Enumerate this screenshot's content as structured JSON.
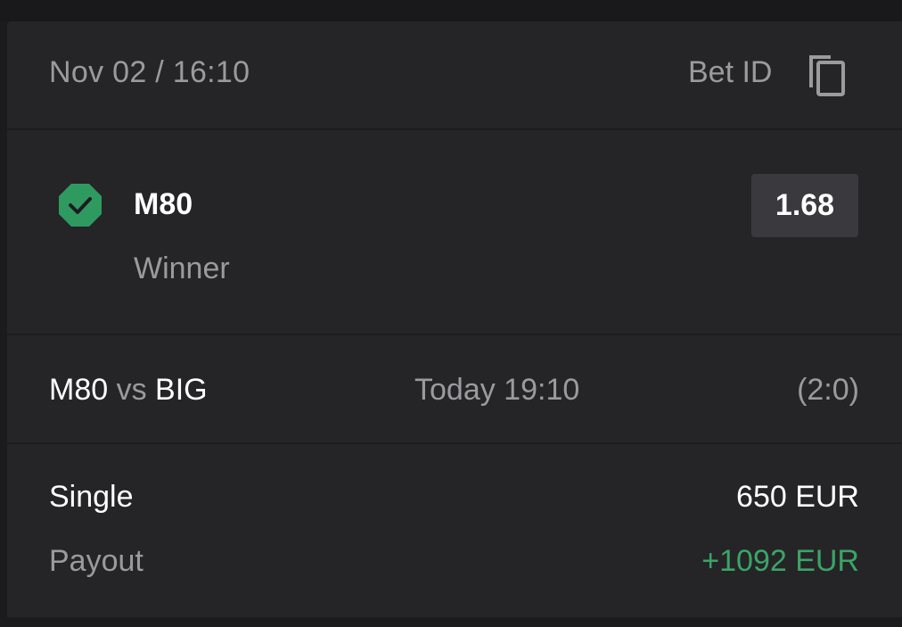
{
  "header": {
    "date": "Nov 02 / 16:10",
    "bet_id_label": "Bet ID",
    "copy_icon": "copy-icon"
  },
  "selection": {
    "status_icon": "check-octagon-icon",
    "status_color": "#2f9a5f",
    "name": "M80",
    "market": "Winner",
    "odds": "1.68"
  },
  "event": {
    "team_home": "M80",
    "vs": "vs",
    "team_away": "BIG",
    "time": "Today 19:10",
    "score": "(2:0)"
  },
  "summary": {
    "bet_type": "Single",
    "stake": "650 EUR",
    "payout_label": "Payout",
    "payout_value": "+1092 EUR",
    "payout_color": "#3aa566"
  }
}
